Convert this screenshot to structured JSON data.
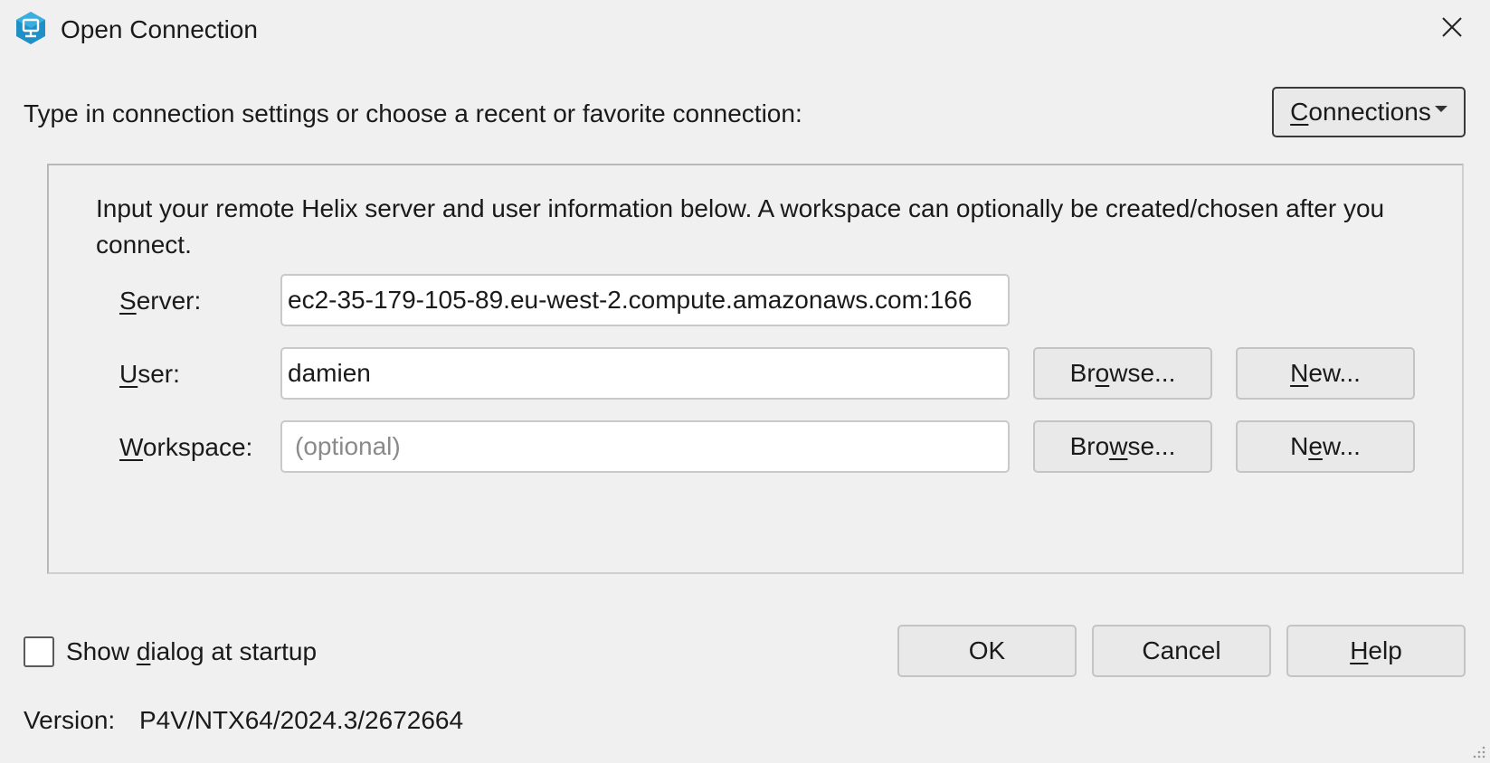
{
  "window": {
    "title": "Open Connection",
    "app_icon": "p4v-connection-icon",
    "close_icon": "close-icon"
  },
  "intro_text": "Type in connection settings or choose a recent or favorite connection:",
  "connections_button": {
    "label_prefix": "C",
    "label_rest": "onnections"
  },
  "panel": {
    "description": "Input your remote Helix server and user information below. A workspace can optionally be created/chosen after you connect.",
    "server": {
      "label_prefix": "S",
      "label_rest": "erver:",
      "value": "ec2-35-179-105-89.eu-west-2.compute.amazonaws.com:166"
    },
    "user": {
      "label_prefix": "U",
      "label_rest": "ser:",
      "value": "damien",
      "browse_a": "Br",
      "browse_u": "o",
      "browse_b": "wse...",
      "new_u": "N",
      "new_b": "ew..."
    },
    "workspace": {
      "label_prefix": "W",
      "label_rest": "orkspace:",
      "placeholder": "(optional)",
      "browse_a": "Bro",
      "browse_u": "w",
      "browse_b": "se...",
      "new_a": "N",
      "new_u": "e",
      "new_b": "w..."
    }
  },
  "show_dialog": {
    "label_a": "Show ",
    "label_u": "d",
    "label_b": "ialog at startup",
    "checked": false
  },
  "buttons": {
    "ok": "OK",
    "cancel": "Cancel",
    "help_u": "H",
    "help_b": "elp"
  },
  "version": {
    "label": "Version:",
    "value": "P4V/NTX64/2024.3/2672664"
  }
}
